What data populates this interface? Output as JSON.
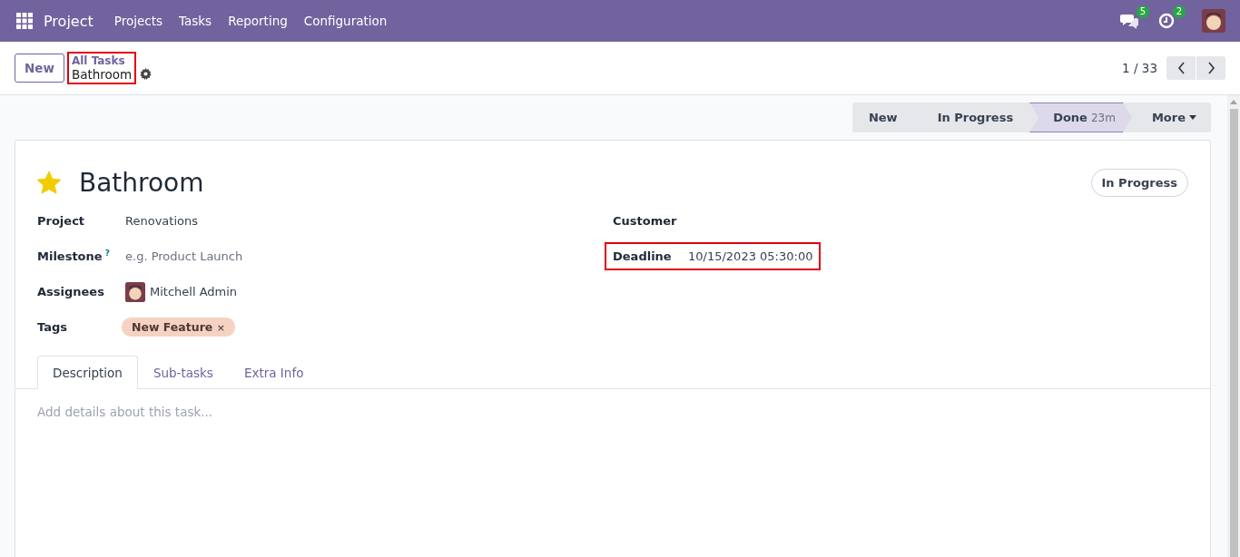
{
  "navbar": {
    "app_name": "Project",
    "menus": [
      "Projects",
      "Tasks",
      "Reporting",
      "Configuration"
    ],
    "messages_count": "5",
    "activities_count": "2"
  },
  "control_panel": {
    "new_button": "New",
    "breadcrumb": {
      "parent": "All Tasks",
      "current": "Bathroom",
      "highlighted": true
    },
    "pager": "1 / 33"
  },
  "stages": [
    {
      "label": "New",
      "selected": false
    },
    {
      "label": "In Progress",
      "selected": false
    },
    {
      "label": "Done",
      "selected": true,
      "duration": "23m"
    }
  ],
  "more_button": "More",
  "task": {
    "title": "Bathroom",
    "starred": true,
    "state": "In Progress"
  },
  "left_fields": [
    {
      "label": "Project",
      "kind": "text",
      "value": "Renovations"
    },
    {
      "label": "Milestone",
      "kind": "placeholder",
      "help": "?",
      "placeholder": "e.g. Product Launch"
    },
    {
      "label": "Assignees",
      "kind": "user",
      "value": "Mitchell Admin"
    },
    {
      "label": "Tags",
      "kind": "tag",
      "value": "New Feature",
      "remove": "×"
    }
  ],
  "right_fields": [
    {
      "label": "Customer",
      "highlighted": false
    },
    {
      "label": "Deadline",
      "value": "10/15/2023 05:30:00",
      "highlighted": true
    }
  ],
  "tabs": [
    {
      "label": "Description",
      "selected": true
    },
    {
      "label": "Sub-tasks",
      "selected": false
    },
    {
      "label": "Extra Info",
      "selected": false
    }
  ],
  "description": {
    "placeholder": "Add details about this task..."
  }
}
